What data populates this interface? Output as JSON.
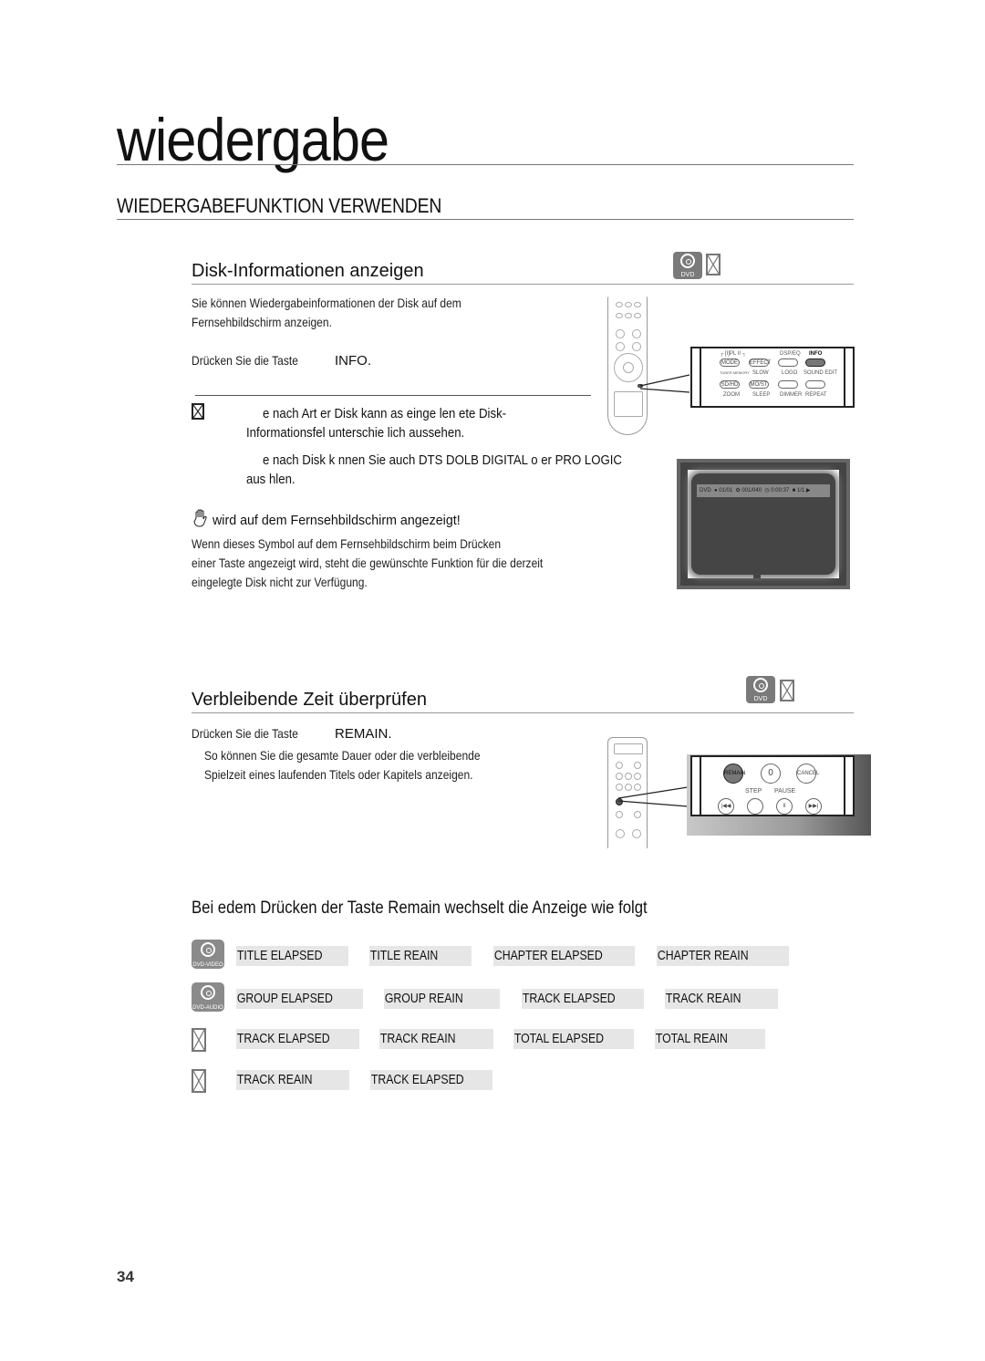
{
  "header": {
    "chapter": "wiedergabe",
    "section": "WIEDERGABEFUNKTION VERWENDEN"
  },
  "disk_info": {
    "title": "Disk-Informationen anzeigen",
    "badges": [
      "DVD",
      "cd-blocked-icon"
    ],
    "intro_line1": "Sie können Wiedergabeinformationen der Disk auf dem",
    "intro_line2": "Fernsehbildschirm anzeigen.",
    "press_prefix": "Drücken Sie die Taste",
    "press_key": "INFO",
    "note1_line1": "e nach Art     er Disk kann     as einge     len     ete Disk-",
    "note1_line2": "Informationsfel     unterschie     lich aussehen.",
    "note2_line1": "e nach Disk k     nnen Sie auch DTS     DOLB     DIGITAL o     er PRO LOGIC",
    "note2_line2": "aus        hlen.",
    "warning_title": "wird auf dem Fernsehbildschirm angezeigt!",
    "warning_line1": "Wenn dieses Symbol auf dem Fernsehbildschirm beim Drücken",
    "warning_line2": "einer Taste angezeigt wird, steht die gewünschte Funktion für die derzeit",
    "warning_line3": "eingelegte Disk nicht zur Verfügung.",
    "remote_callout": {
      "row1_header": "┌ [I]PL II ┐",
      "buttons_row1": [
        "MODE",
        "EFFECT",
        "DSP/EQ",
        "INFO"
      ],
      "labels_row2": [
        "TUNER MEMORY",
        "SLOW",
        "LOGO",
        "SOUND EDIT"
      ],
      "buttons_row2": [
        "SD/HD",
        "MO/ST",
        "",
        ""
      ],
      "labels_row3": [
        "ZOOM",
        "SLEEP",
        "DIMMER",
        "REPEAT"
      ]
    },
    "osd": {
      "disc": "DVD",
      "title": "01/01",
      "chapter": "001/040",
      "time": "0:00:37",
      "angle": "1/1",
      "play": "▶"
    }
  },
  "remain": {
    "title": "Verbleibende Zeit überprüfen",
    "badges": [
      "DVD",
      "cd-blocked-icon"
    ],
    "press_prefix": "Drücken Sie die Taste",
    "press_key": "REMAIN",
    "desc_line1": "So können Sie die gesamte Dauer oder die verbleibende",
    "desc_line2": "Spielzeit eines laufenden Titels oder Kapitels anzeigen.",
    "remote_callout": {
      "buttons_row1": [
        "REMAIN",
        "0",
        "CANCEL"
      ],
      "labels_row2": [
        "STEP",
        "PAUSE"
      ],
      "buttons_row2": [
        "|◀◀",
        "",
        "II",
        "▶▶|"
      ]
    }
  },
  "sequence": {
    "heading": "Bei edem Drücken der Taste Remain wechselt die Anzeige wie folgt",
    "rows": [
      {
        "icon": "DVD-VIDEO",
        "items": [
          "TITLE ELAPSED",
          "TITLE REAIN",
          "CHAPTER ELAPSED",
          "CHAPTER REAIN"
        ]
      },
      {
        "icon": "DVD-AUDIO",
        "items": [
          "GROUP ELAPSED",
          "GROUP REAIN",
          "TRACK ELAPSED",
          "TRACK REAIN"
        ]
      },
      {
        "icon": "blocked",
        "items": [
          "TRACK ELAPSED",
          "TRACK REAIN",
          "TOTAL ELAPSED",
          "TOTAL REAIN"
        ]
      },
      {
        "icon": "blocked",
        "items": [
          "TRACK REAIN",
          "TRACK ELAPSED"
        ]
      }
    ]
  },
  "footer": {
    "page_number": "34"
  }
}
